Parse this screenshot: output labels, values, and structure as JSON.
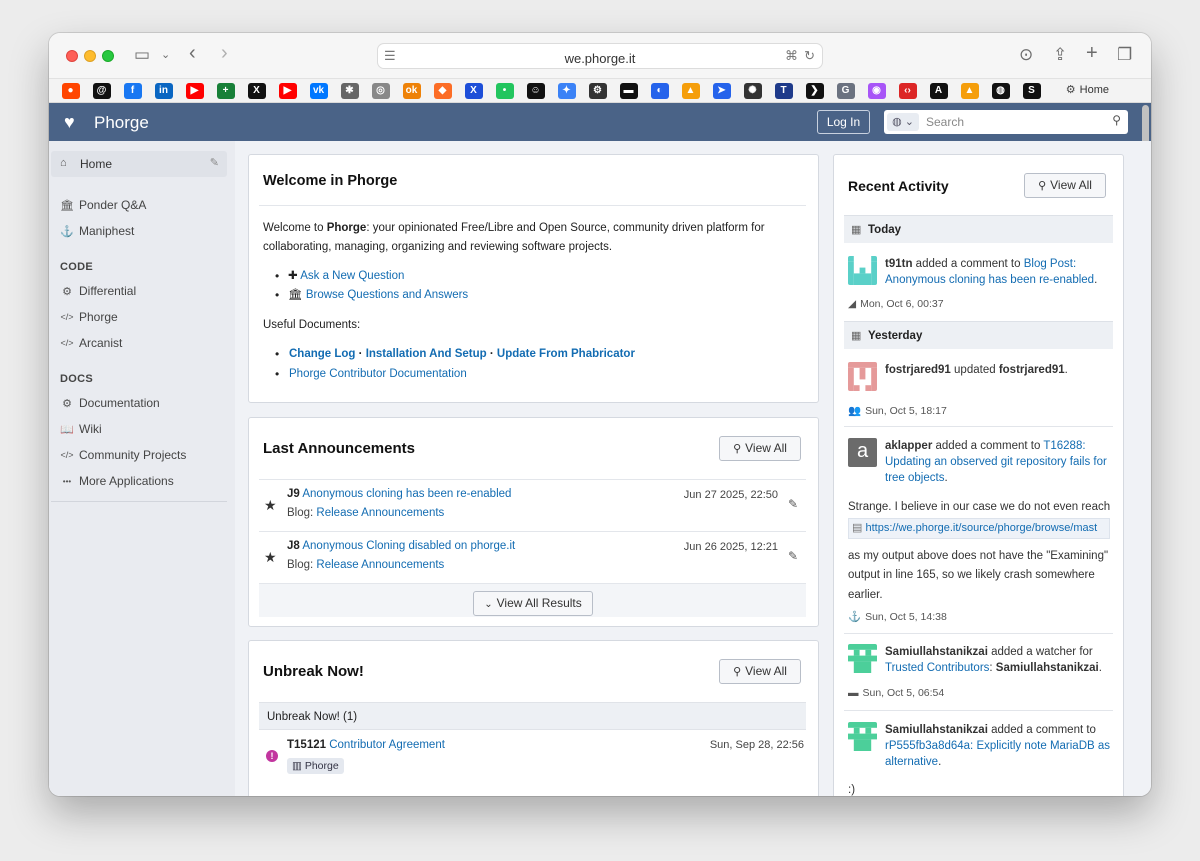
{
  "browser": {
    "url": "we.phorge.it",
    "bookmark_home": "Home"
  },
  "favicons": [
    {
      "name": "reddit-icon",
      "color": "#ff4500",
      "glyph": "●"
    },
    {
      "name": "threads-icon",
      "color": "#111111",
      "glyph": "@"
    },
    {
      "name": "facebook-icon",
      "color": "#1877f2",
      "glyph": "f"
    },
    {
      "name": "linkedin-icon",
      "color": "#0a66c2",
      "glyph": "in"
    },
    {
      "name": "youtube-icon",
      "color": "#ff0000",
      "glyph": "▶"
    },
    {
      "name": "sheets-icon",
      "color": "#188038",
      "glyph": "+"
    },
    {
      "name": "x-icon",
      "color": "#111111",
      "glyph": "X"
    },
    {
      "name": "youtube-icon",
      "color": "#ff0000",
      "glyph": "▶"
    },
    {
      "name": "vk-icon",
      "color": "#0077ff",
      "glyph": "vk"
    },
    {
      "name": "settings-icon",
      "color": "#666666",
      "glyph": "✱"
    },
    {
      "name": "compass-icon",
      "color": "#888888",
      "glyph": "◎"
    },
    {
      "name": "ok-icon",
      "color": "#ee8208",
      "glyph": "ok"
    },
    {
      "name": "gitlab-icon",
      "color": "#fc6d26",
      "glyph": "◆"
    },
    {
      "name": "x-blue-icon",
      "color": "#1d4ed8",
      "glyph": "X"
    },
    {
      "name": "dot-icon",
      "color": "#22c55e",
      "glyph": "•"
    },
    {
      "name": "smiley-icon",
      "color": "#111111",
      "glyph": "☺"
    },
    {
      "name": "gemini-icon",
      "color": "#3b82f6",
      "glyph": "✦"
    },
    {
      "name": "gear-icon",
      "color": "#333333",
      "glyph": "⚙"
    },
    {
      "name": "dark-app-icon",
      "color": "#111111",
      "glyph": "▬"
    },
    {
      "name": "circle-app-icon",
      "color": "#2563eb",
      "glyph": "◐"
    },
    {
      "name": "analytics-icon",
      "color": "#f59e0b",
      "glyph": "▲"
    },
    {
      "name": "rocket-icon",
      "color": "#2563eb",
      "glyph": "➤"
    },
    {
      "name": "openai-icon",
      "color": "#333333",
      "glyph": "✺"
    },
    {
      "name": "t-icon",
      "color": "#1e3a8a",
      "glyph": "T"
    },
    {
      "name": "chevron-icon",
      "color": "#111111",
      "glyph": "❯"
    },
    {
      "name": "g-icon",
      "color": "#6b7280",
      "glyph": "G"
    },
    {
      "name": "podcast-icon",
      "color": "#a855f7",
      "glyph": "◉"
    },
    {
      "name": "code-icon",
      "color": "#dc2626",
      "glyph": "‹›"
    },
    {
      "name": "ai-icon",
      "color": "#111111",
      "glyph": "A"
    },
    {
      "name": "analytics-icon",
      "color": "#f59e0b",
      "glyph": "▲"
    },
    {
      "name": "github-icon",
      "color": "#111111",
      "glyph": "◍"
    },
    {
      "name": "s-icon",
      "color": "#111111",
      "glyph": "S"
    }
  ],
  "header": {
    "title": "Phorge",
    "login": "Log In",
    "search_placeholder": "Search"
  },
  "sidebar": {
    "home": "Home",
    "apps": [
      {
        "label": "Ponder Q&A",
        "icon": "🏛"
      },
      {
        "label": "Maniphest",
        "icon": "⚓"
      }
    ],
    "code_head": "CODE",
    "code": [
      {
        "label": "Differential",
        "icon": "⚙"
      },
      {
        "label": "Phorge",
        "icon": "</>"
      },
      {
        "label": "Arcanist",
        "icon": "</>"
      }
    ],
    "docs_head": "DOCS",
    "docs": [
      {
        "label": "Documentation",
        "icon": "⚙"
      },
      {
        "label": "Wiki",
        "icon": "📖"
      },
      {
        "label": "Community Projects",
        "icon": "</>"
      },
      {
        "label": "More Applications",
        "icon": "•••"
      }
    ]
  },
  "welcome": {
    "title": "Welcome in Phorge",
    "intro_pre": "Welcome to ",
    "intro_bold": "Phorge",
    "intro_line1": ": your opinionated Free/Libre and Open Source, community driven platform for",
    "intro_line2": "collaborating, managing, organizing and reviewing software projects.",
    "link_ask": "Ask a New Question",
    "link_browse": "Browse Questions and Answers",
    "useful": "Useful Documents:",
    "doc_changelog": "Change Log",
    "doc_sep": " · ",
    "doc_install": "Installation And Setup",
    "doc_update": "Update From Phabricator",
    "doc_contrib": "Phorge Contributor Documentation"
  },
  "announcements": {
    "title": "Last Announcements",
    "view_all": "View All",
    "items": [
      {
        "id": "J9",
        "title": "Anonymous cloning has been re-enabled",
        "date": "Jun 27 2025, 22:50",
        "blog_label": "Blog: ",
        "blog": "Release Announcements"
      },
      {
        "id": "J8",
        "title": "Anonymous Cloning disabled on phorge.it",
        "date": "Jun 26 2025, 12:21",
        "blog_label": "Blog: ",
        "blog": "Release Announcements"
      }
    ],
    "view_results": "View All Results"
  },
  "unbreak": {
    "title": "Unbreak Now!",
    "view_all": "View All",
    "subhead": "Unbreak Now! (1)",
    "task_id": "T15121",
    "task_title": "Contributor Agreement",
    "task_date": "Sun, Sep 28, 22:56",
    "task_tag": "Phorge"
  },
  "activity": {
    "title": "Recent Activity",
    "view_all": "View All",
    "today": "Today",
    "yesterday": "Yesterday",
    "e1_user": "t91tn",
    "e1_action": " added a comment to ",
    "e1_link": "Blog Post: Anonymous cloning has been re-enabled",
    "e1_end": ".",
    "e1_time": "Mon, Oct 6, 00:37",
    "e2_user": "fostrjared91",
    "e2_action": " updated ",
    "e2_target": "fostrjared91",
    "e2_end": ".",
    "e2_time": "Sun, Oct 5, 18:17",
    "e3_user": "aklapper",
    "e3_action": " added a comment to ",
    "e3_link": "T16288: Updating an observed git repository fails for tree objects",
    "e3_end": ".",
    "e3_body1": "Strange. I believe in our case we do not even reach",
    "e3_url": "https://we.phorge.it/source/phorge/browse/mast",
    "e3_body2": "as my output above does not have the \"Examining\" output in line 165, so we likely crash somewhere earlier.",
    "e3_time": "Sun, Oct 5, 14:38",
    "e4_user": "Samiullahstanikzai",
    "e4_action": " added a watcher for ",
    "e4_link": "Trusted Contributors",
    "e4_colon": ": ",
    "e4_target": "Samiullahstanikzai",
    "e4_end": ".",
    "e4_time": "Sun, Oct 5, 06:54",
    "e5_user": "Samiullahstanikzai",
    "e5_action": " added a comment to ",
    "e5_link": "rP555fb3a8d64a: Explicitly note MariaDB as alternative",
    "e5_end": ".",
    "e5_body": ":)"
  },
  "colors": {
    "header": "#4a6387",
    "link": "#136cb2",
    "priority": "#c2359f"
  }
}
